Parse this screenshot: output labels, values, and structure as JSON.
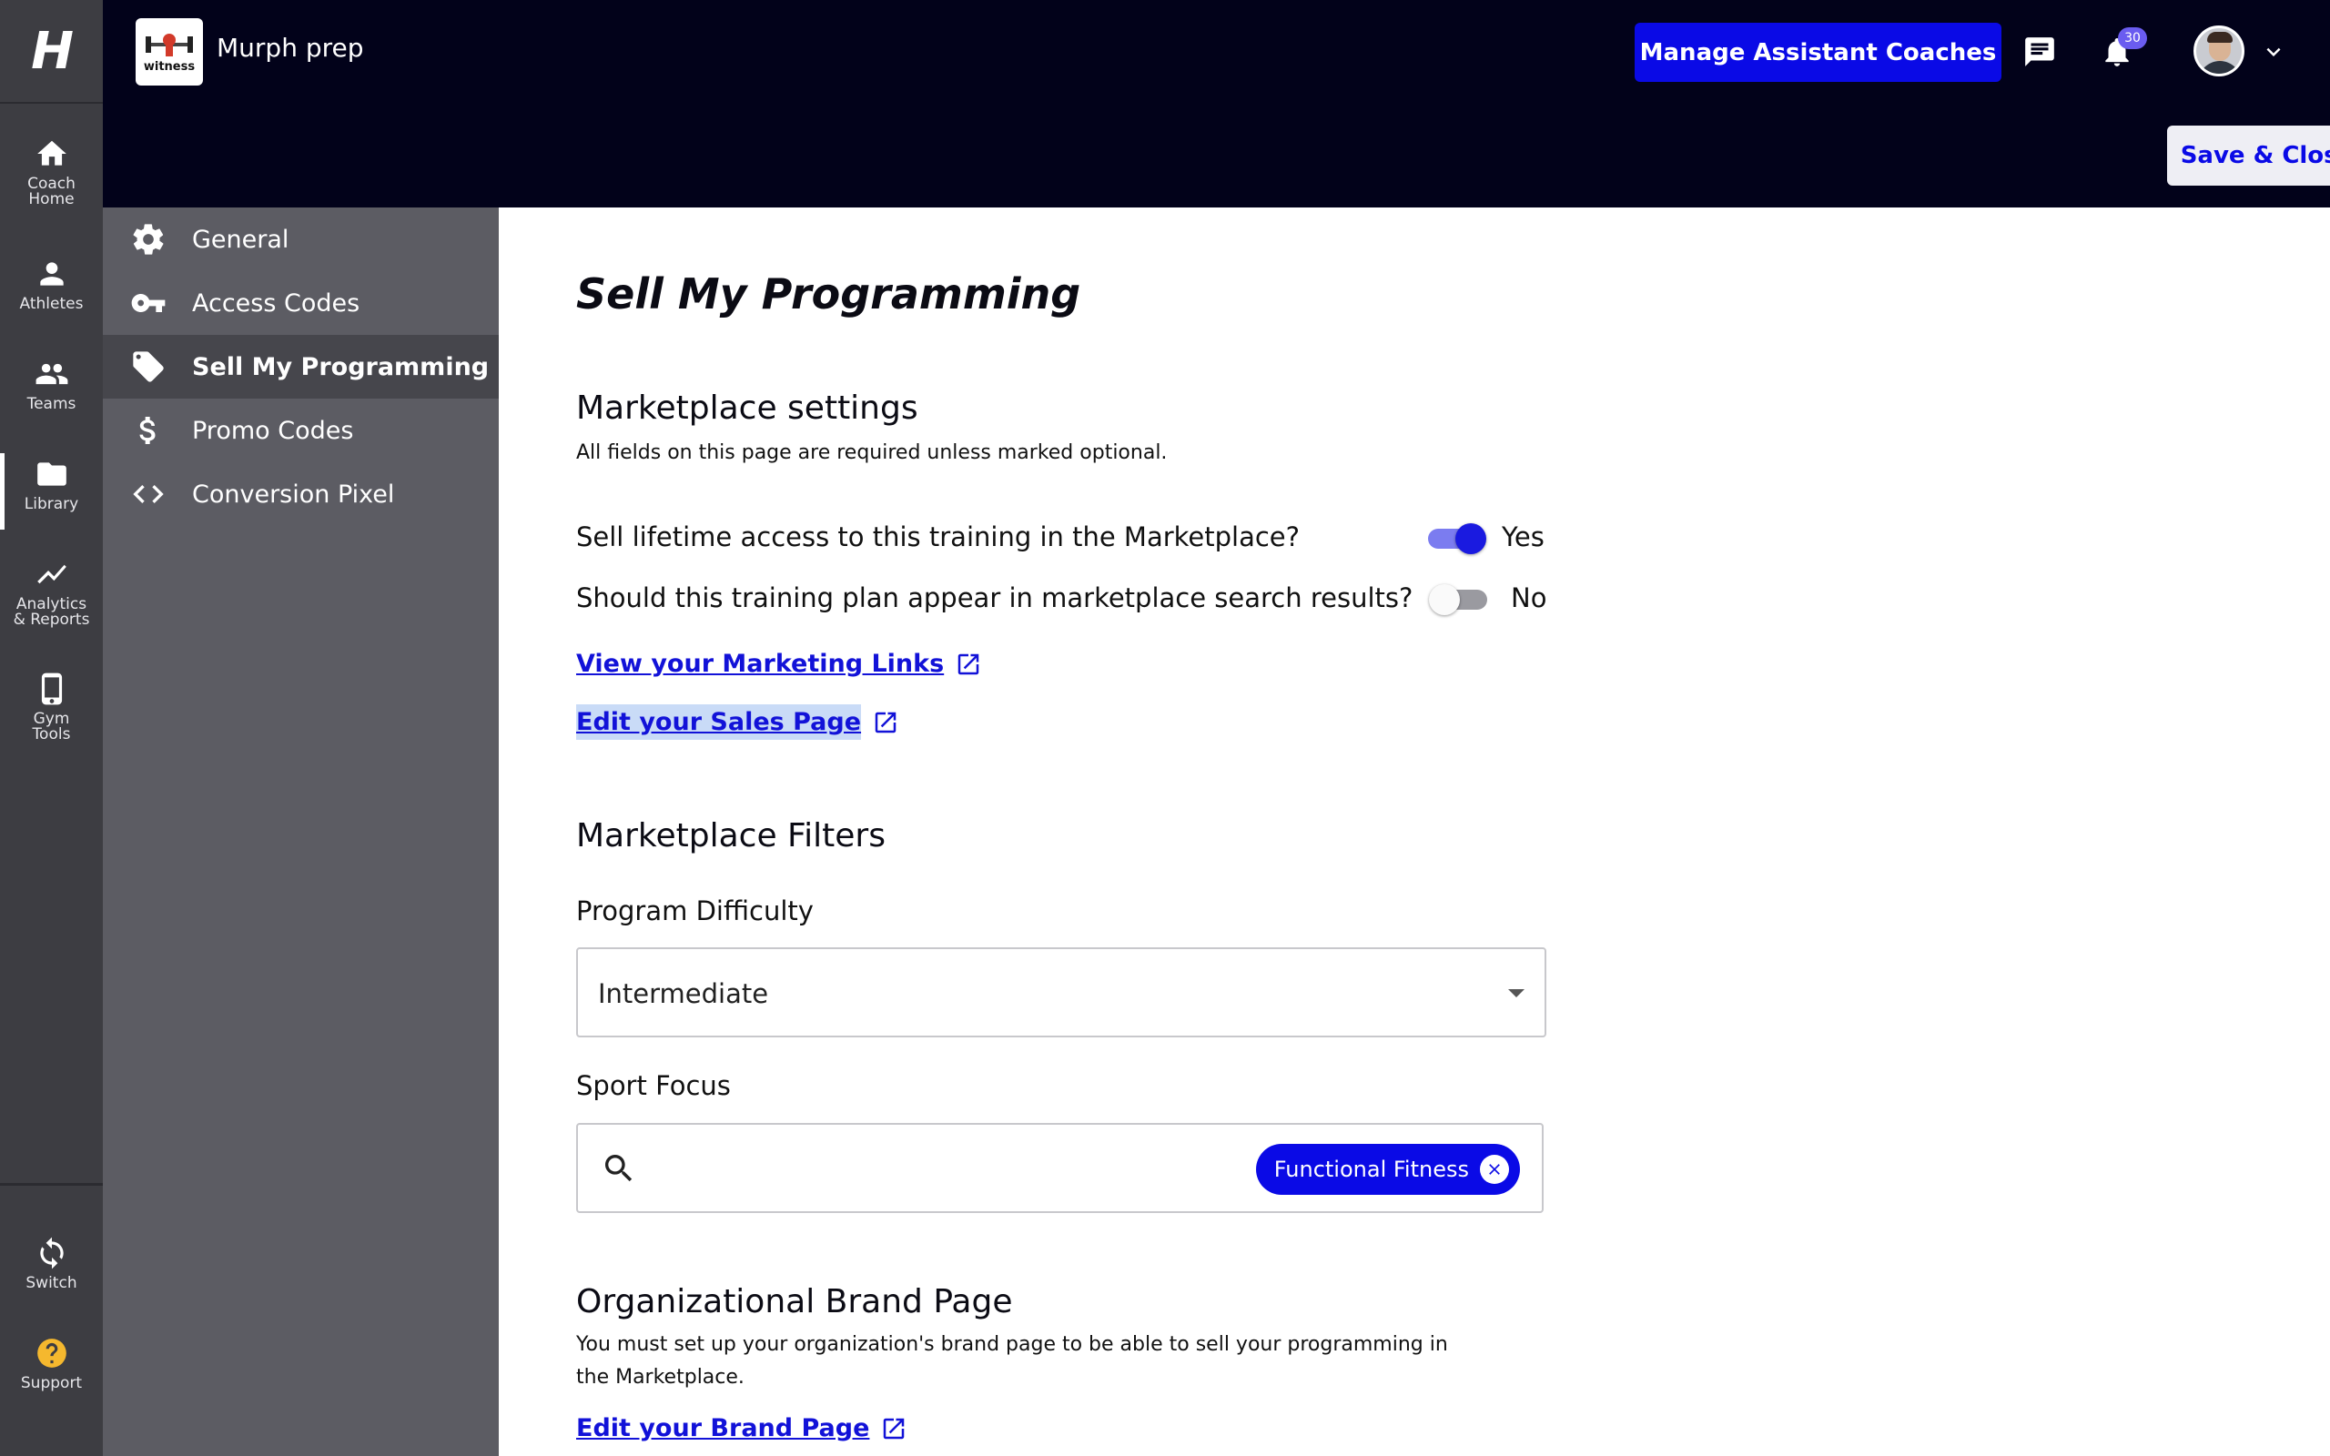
{
  "rail": {
    "logo": "H",
    "items": [
      {
        "label": "Coach\nHome",
        "icon": "home-icon"
      },
      {
        "label": "Athletes",
        "icon": "person-icon"
      },
      {
        "label": "Teams",
        "icon": "group-icon"
      },
      {
        "label": "Library",
        "icon": "folder-icon"
      },
      {
        "label": "Analytics\n& Reports",
        "icon": "trend-icon"
      },
      {
        "label": "Gym\nTools",
        "icon": "phone-icon"
      },
      {
        "label": "Switch",
        "icon": "sync-icon"
      },
      {
        "label": "Support",
        "icon": "help-icon"
      }
    ]
  },
  "header": {
    "org_logo_text": "witness",
    "org_name": "Murph prep",
    "manage_button": "Manage Assistant Coaches",
    "notification_count": "30",
    "save_close": "Save & Close"
  },
  "subnav": {
    "items": [
      {
        "label": "General",
        "icon": "gear-icon"
      },
      {
        "label": "Access Codes",
        "icon": "key-icon"
      },
      {
        "label": "Sell My Programming",
        "icon": "tag-icon",
        "active": true
      },
      {
        "label": "Promo Codes",
        "icon": "dollar-icon"
      },
      {
        "label": "Conversion Pixel",
        "icon": "code-icon"
      }
    ]
  },
  "main": {
    "title": "Sell My Programming",
    "marketplace_settings": {
      "heading": "Marketplace settings",
      "subtext": "All fields on this page are required unless marked optional.",
      "q1": "Sell lifetime access to this training in the Marketplace?",
      "q1_value": "Yes",
      "q2": "Should this training plan appear in marketplace search results?",
      "q2_value": "No",
      "link_marketing": "View your Marketing Links",
      "link_sales": "Edit your Sales Page"
    },
    "filters": {
      "heading": "Marketplace Filters",
      "difficulty_label": "Program Difficulty",
      "difficulty_value": "Intermediate",
      "sport_label": "Sport Focus",
      "sport_tag": "Functional Fitness"
    },
    "brand": {
      "heading": "Organizational Brand Page",
      "text_line1": "You must set up your organization's brand page to be able to sell your programming in",
      "text_line2": "the Marketplace.",
      "link": "Edit your Brand Page"
    }
  },
  "colors": {
    "accent": "#0a0ae6",
    "topbar": "#02021a",
    "rail": "#3d3d42",
    "subnav": "#5c5c63",
    "link": "#1212d8"
  }
}
